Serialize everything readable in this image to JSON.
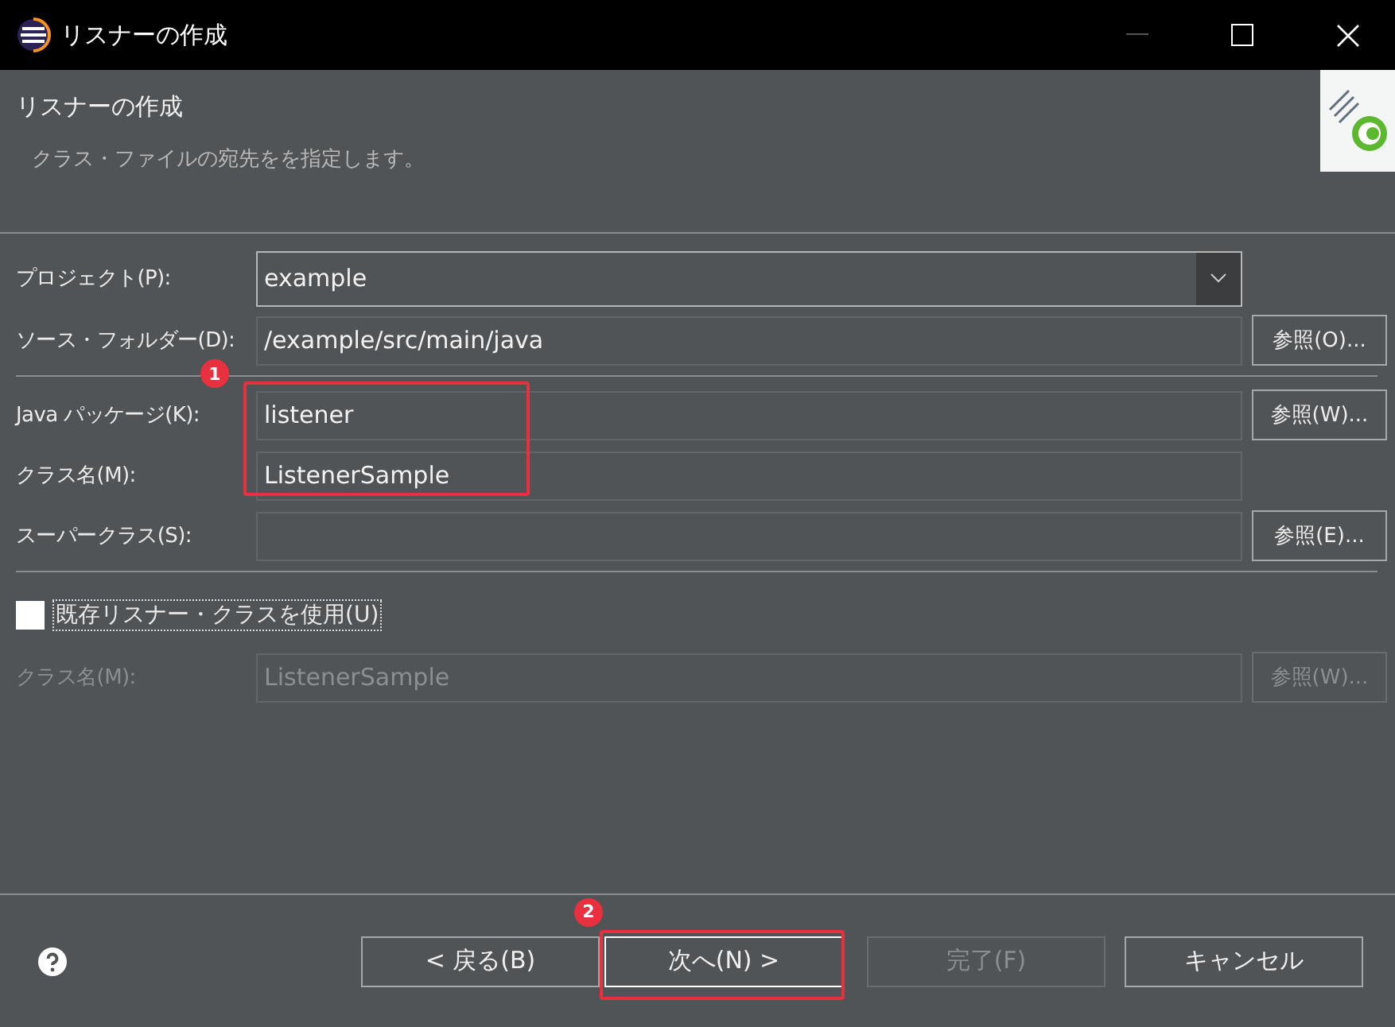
{
  "window": {
    "title": "リスナーの作成"
  },
  "header": {
    "title": "リスナーの作成",
    "description": "クラス・ファイルの宛先をを指定します。"
  },
  "project": {
    "label": "プロジェクト(P):",
    "value": "example"
  },
  "source_folder": {
    "label": "ソース・フォルダー(D):",
    "value": "/example/src/main/java",
    "button": "参照(O)..."
  },
  "package": {
    "label": "Java パッケージ(K):",
    "value": "listener",
    "button": "参照(W)..."
  },
  "class_name": {
    "label": "クラス名(M):",
    "value": "ListenerSample"
  },
  "superclass": {
    "label": "スーパークラス(S):",
    "button": "参照(E)..."
  },
  "existing": {
    "label": "既存リスナー・クラスを使用(U)",
    "checked": false
  },
  "existing_class": {
    "label": "クラス名(M):",
    "value": "ListenerSample",
    "button": "参照(W)...",
    "disabled": true
  },
  "annotations": [
    {
      "number": "1"
    },
    {
      "number": "2"
    }
  ],
  "buttons": [
    {
      "label": "< 戻る(B)",
      "disabled": false
    },
    {
      "label": "次へ(N) >",
      "disabled": false
    },
    {
      "label": "完了(F)",
      "disabled": true
    },
    {
      "label": "キャンセル",
      "disabled": false
    }
  ]
}
